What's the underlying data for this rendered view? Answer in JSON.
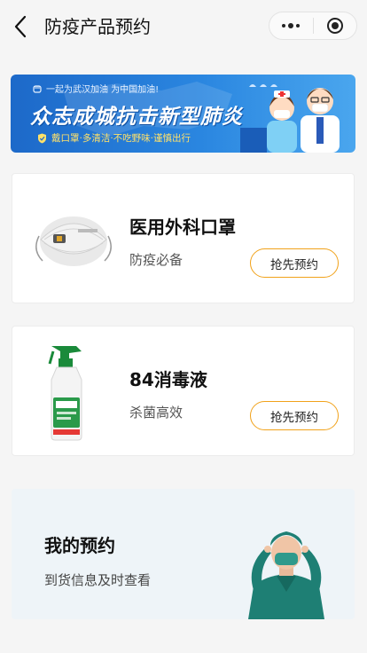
{
  "header": {
    "title": "防疫产品预约",
    "back_icon": "chevron-left-icon",
    "menu_icon": "more-dots-icon",
    "close_icon": "target-circle-icon"
  },
  "banner": {
    "tagline": "一起为武汉加油 为中国加油!",
    "headline": "众志成城抗击新型肺炎",
    "subline": "戴口罩·多清洁·不吃野味·谨慎出行",
    "colors": {
      "start": "#1d69c9",
      "end": "#4aa6ee",
      "subline": "#ffe16a"
    }
  },
  "products": [
    {
      "name": "医用外科口罩",
      "desc": "防疫必备",
      "button": "抢先预约",
      "image": "mask-image"
    },
    {
      "name": "84消毒液",
      "desc": "杀菌高效",
      "button": "抢先预约",
      "image": "disinfectant-bottle-image"
    }
  ],
  "my_reservation": {
    "title": "我的预约",
    "subtitle": "到货信息及时查看",
    "image": "nurse-illustration"
  },
  "colors": {
    "accent": "#f1a21a",
    "background": "#f5f5f5"
  }
}
